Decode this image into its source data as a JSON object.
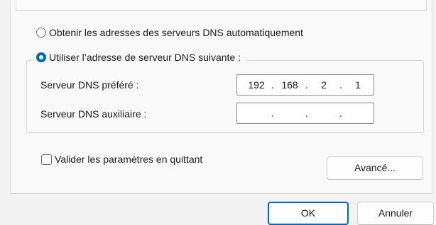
{
  "dns": {
    "auto_label": "Obtenir les adresses des serveurs DNS automatiquement",
    "manual_label": "Utiliser l’adresse de serveur DNS suivante :",
    "selected": "manual",
    "preferred": {
      "label": "Serveur DNS préféré :",
      "octets": [
        "192",
        "168",
        "2",
        "1"
      ]
    },
    "alternate": {
      "label": "Serveur DNS auxiliaire :",
      "octets": [
        "",
        "",
        "",
        ""
      ]
    }
  },
  "validate_checkbox": {
    "label": "Valider les paramètres en quittant",
    "checked": false
  },
  "buttons": {
    "advanced": "Avancé...",
    "ok": "OK",
    "cancel": "Annuler"
  },
  "colors": {
    "accent": "#0067c0"
  }
}
